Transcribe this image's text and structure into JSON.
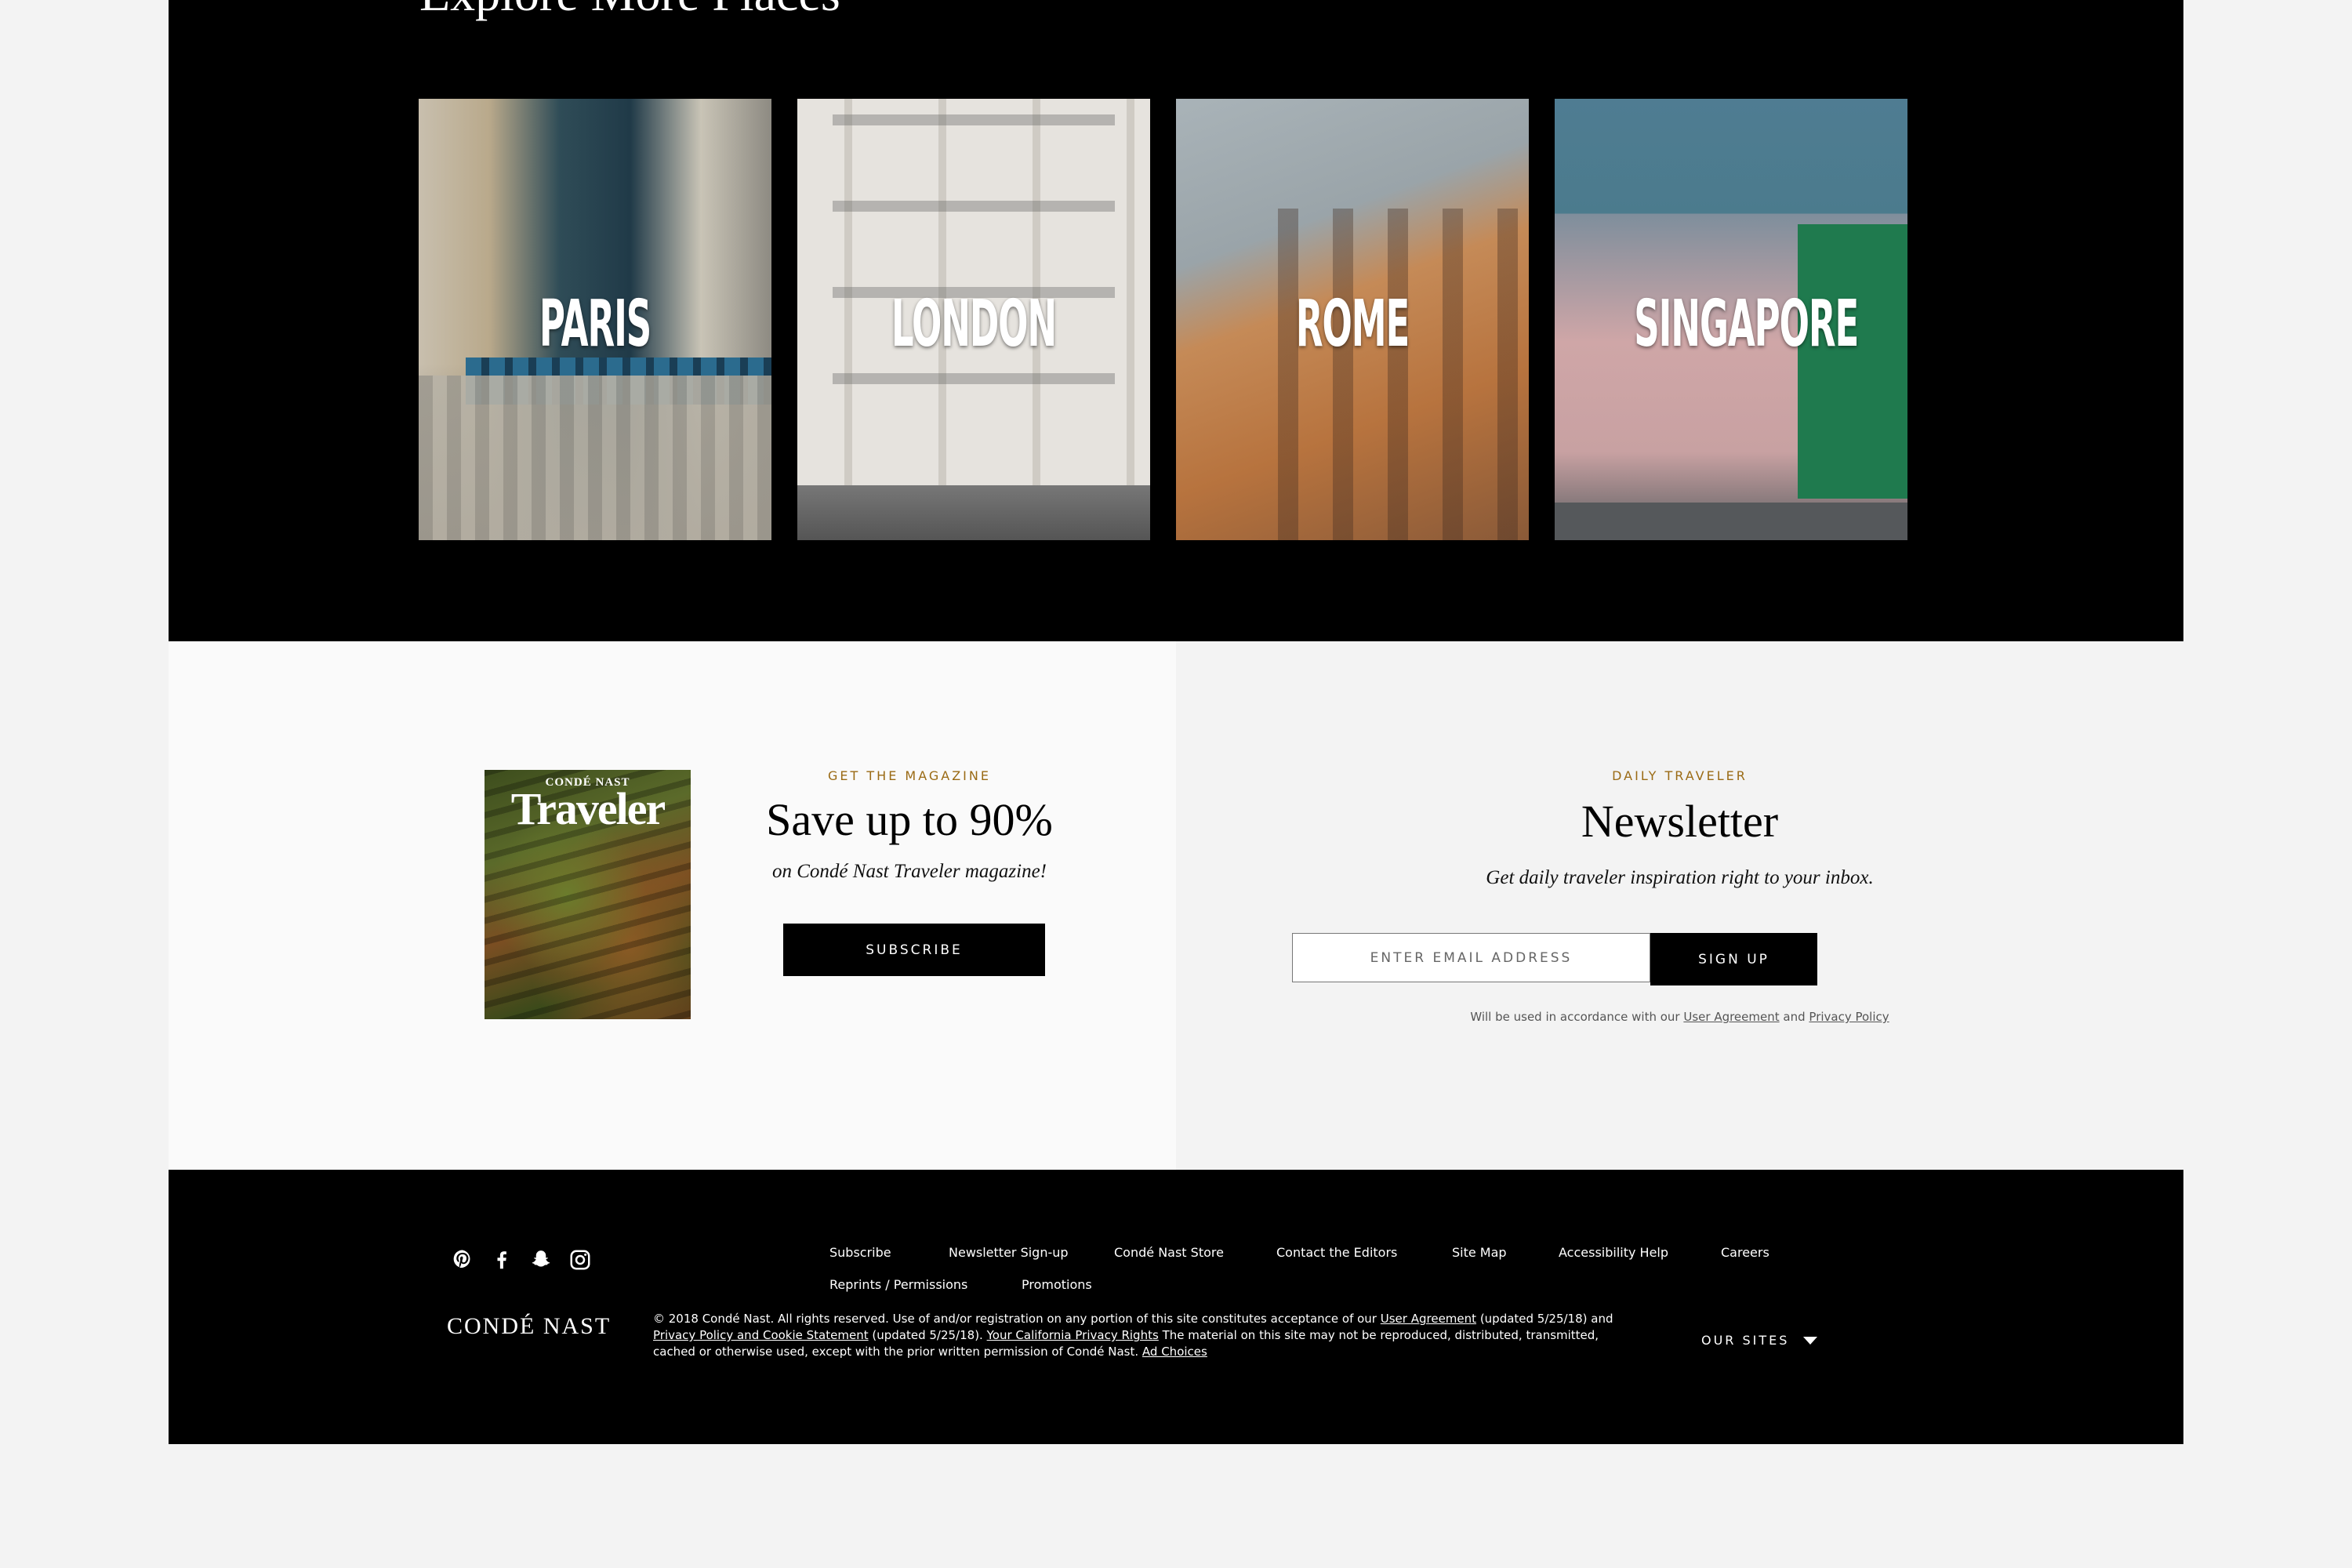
{
  "explore": {
    "title": "Explore More Places",
    "cards": [
      {
        "label": "PARIS"
      },
      {
        "label": "LONDON"
      },
      {
        "label": "ROME"
      },
      {
        "label": "SINGAPORE"
      }
    ]
  },
  "magazine": {
    "cover_brand_top": "CONDÉ NAST",
    "cover_brand_main": "Traveler",
    "eyebrow": "GET THE MAGAZINE",
    "heading": "Save up to 90%",
    "subheading": "on Condé Nast Traveler magazine!",
    "button_label": "SUBSCRIBE"
  },
  "newsletter": {
    "eyebrow": "DAILY TRAVELER",
    "heading": "Newsletter",
    "subheading": "Get daily traveler inspiration right to your inbox.",
    "email_placeholder": "ENTER EMAIL ADDRESS",
    "button_label": "SIGN UP",
    "legal_prefix": "Will be used in accordance with our",
    "legal_user_agreement": "User Agreement",
    "legal_and": "and",
    "legal_privacy": "Privacy Policy"
  },
  "footer": {
    "socials": [
      "pinterest-icon",
      "facebook-icon",
      "snapchat-icon",
      "instagram-icon"
    ],
    "nav": [
      "Subscribe",
      "Newsletter Sign-up",
      "Condé Nast Store",
      "Contact the Editors",
      "Site Map",
      "Accessibility Help",
      "Careers",
      "Reprints / Permissions",
      "Promotions"
    ],
    "logo": "CONDÉ NAST",
    "copyright": {
      "part1": "© 2018 Condé Nast. All rights reserved. Use of and/or registration on any portion of this site constitutes acceptance of our",
      "user_agreement": "User Agreement",
      "part2": "(updated 5/25/18) and",
      "privacy_cookie": "Privacy Policy and Cookie Statement",
      "part3": "(updated 5/25/18).",
      "california": "Your California Privacy Rights",
      "part4": "The material on this site may not be reproduced, distributed, transmitted, cached or otherwise used, except with the prior written permission of Condé Nast.",
      "ad_choices": "Ad Choices"
    },
    "our_sites_label": "OUR SITES"
  }
}
